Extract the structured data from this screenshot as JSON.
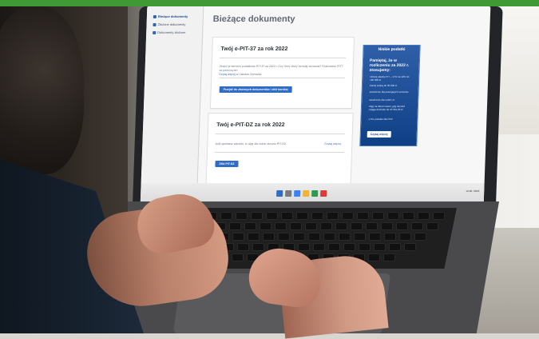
{
  "screen": {
    "title": "Bieżące dokumenty",
    "sidebar": [
      {
        "label": "Bieżące dokumenty"
      },
      {
        "label": "Złożone dokumenty"
      },
      {
        "label": "Dokumenty złożone"
      }
    ],
    "card1": {
      "title": "Twój e-PIT-37 za rok 2022",
      "line1": "Złożyć je terminie podatkowe PIT-37 za 2022 r. Czy, firmy złoży formułę zeznania? Rozliczeniu PIT?",
      "line2": "za pomocą ten",
      "link": "Czytaj więcej",
      "link_suffix": "w Usłudze Zeznania",
      "button": "Przejdź do złożonych dokumentów i złóż korektę"
    },
    "card2": {
      "title": "Twój e-PIT-DZ za rok 2022",
      "line1": "Jeśli spełniasz warunki, to ulgę dla rodzin złożysz PIT-DZ.",
      "link": "Czytaj więcej",
      "button": "Złóż PIT-DZ"
    },
    "promo": {
      "header": "Niskie podatki",
      "title": "Pamiętaj, że w rozliczeniu za 2022 r. stosujemy:",
      "items": [
        "Niższą stawkę PIT – 17% na 12% do 120 000 zł",
        "Kwotę wolną do 30 000 zł",
        "Zwolnienie dla pracujących seniorów",
        "Zwolnienie dla rodzin 4+",
        "Ulgę na dzieci nawet, gdy dochód osiąga dochodu do 10 361,20 zł",
        "1,5% podatku dla OPP"
      ],
      "button": "Czytaj więcej"
    },
    "taskbar_clock": "12:00 / 2023"
  },
  "colors": {
    "brand_green": "#3f9a36",
    "screen_blue": "#2f6cc6",
    "promo_blue": "#0f3f84"
  }
}
